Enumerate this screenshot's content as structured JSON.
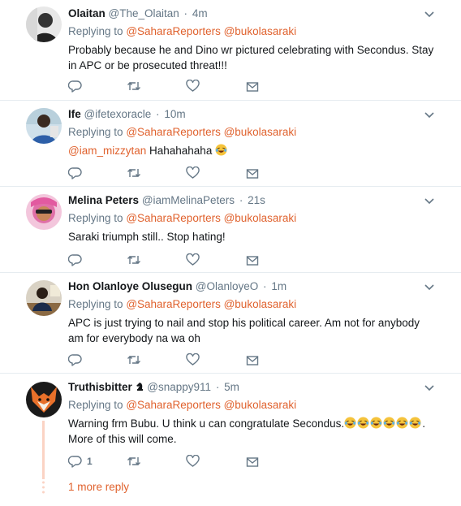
{
  "tweets": [
    {
      "name": "Olaitan",
      "handle": "@The_Olaitan",
      "sep": "·",
      "time": "4m",
      "replying_to_label": "Replying to",
      "mentions": [
        "@SaharaReporters",
        "@bukolasaraki"
      ],
      "text": "Probably because he and Dino wr pictured celebrating with Secondus. Stay in APC or be prosecuted threat!!!",
      "avatar_icon": "avatar-bw-portrait"
    },
    {
      "name": "Ife",
      "handle": "@ifetexoracle",
      "sep": "·",
      "time": "10m",
      "replying_to_label": "Replying to",
      "mentions": [
        "@SaharaReporters",
        "@bukolasaraki"
      ],
      "text_mention": "@iam_mizzytan",
      "text": "Hahahahaha",
      "avatar_icon": "avatar-man-blue-shirt"
    },
    {
      "name": "Melina Peters",
      "handle": "@iamMelinaPeters",
      "sep": "·",
      "time": "21s",
      "replying_to_label": "Replying to",
      "mentions": [
        "@SaharaReporters",
        "@bukolasaraki"
      ],
      "text": "Saraki triumph still.. Stop hating!",
      "avatar_icon": "avatar-woman-pink"
    },
    {
      "name": "Hon Olanloye Olusegun",
      "handle": "@OlanloyeO",
      "sep": "·",
      "time": "1m",
      "replying_to_label": "Replying to",
      "mentions": [
        "@SaharaReporters",
        "@bukolasaraki"
      ],
      "text": "APC is just trying to nail and stop his political career. Am not for anybody am for everybody na wa oh",
      "avatar_icon": "avatar-man-office"
    },
    {
      "name": "Truthisbitter",
      "handle": "@snappy911",
      "sep": "·",
      "time": "5m",
      "replying_to_label": "Replying to",
      "mentions": [
        "@SaharaReporters",
        "@bukolasaraki"
      ],
      "text": "Warning frm Bubu. U think u can congratulate Secondus.",
      "text_tail": ".",
      "text_line2": "More of this will come.",
      "reply_count": "1",
      "avatar_icon": "avatar-fox"
    }
  ],
  "more_reply": "1 more reply",
  "colors": {
    "accent": "#e0622e",
    "muted": "#657786",
    "text": "#14171a",
    "icon": "#657786"
  }
}
